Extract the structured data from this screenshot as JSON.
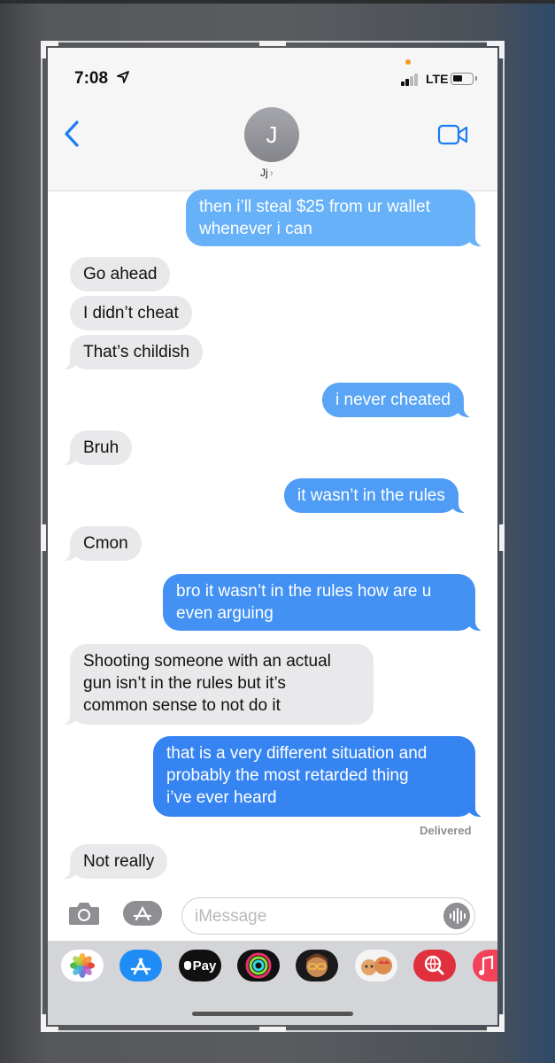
{
  "status": {
    "time": "7:08",
    "network": "LTE"
  },
  "header": {
    "avatar_initial": "J",
    "contact_name": "Jj"
  },
  "messages": [
    {
      "dir": "out",
      "text_lines": [
        "then i’ll steal $25 from ur wallet",
        "whenever i can"
      ]
    },
    {
      "dir": "in",
      "text": "Go ahead"
    },
    {
      "dir": "in",
      "text": "I didn’t cheat"
    },
    {
      "dir": "in",
      "text": "That’s childish"
    },
    {
      "dir": "out",
      "text": "i never cheated"
    },
    {
      "dir": "in",
      "text": "Bruh"
    },
    {
      "dir": "out",
      "text": "it wasn’t in the rules"
    },
    {
      "dir": "in",
      "text": "Cmon"
    },
    {
      "dir": "out",
      "text_lines": [
        "bro it wasn’t in the rules how are u",
        "even arguing"
      ]
    },
    {
      "dir": "in",
      "text_lines": [
        "Shooting someone with an actual",
        "gun isn’t in the rules but it’s",
        "common sense to not do it"
      ]
    },
    {
      "dir": "out",
      "text_lines": [
        "that is a very different situation and",
        "probably the most retarded thing",
        "i’ve ever heard"
      ]
    },
    {
      "dir": "in",
      "text": "Not really"
    }
  ],
  "delivered_label": "Delivered",
  "input": {
    "placeholder": "iMessage"
  },
  "drawer": {
    "apps": [
      "photos-icon",
      "app-store-icon",
      "apple-pay-icon",
      "activity-icon",
      "memoji-icon",
      "memoji-stickers-icon",
      "web-search-icon",
      "music-icon"
    ],
    "apple_pay_label": "Pay"
  },
  "colors": {
    "accent": "#1c7cf3",
    "incoming_bubble": "#e9e9eb",
    "outgoing_gradient_top": "#6ab5f8",
    "outgoing_gradient_bottom": "#2f7ff0"
  }
}
